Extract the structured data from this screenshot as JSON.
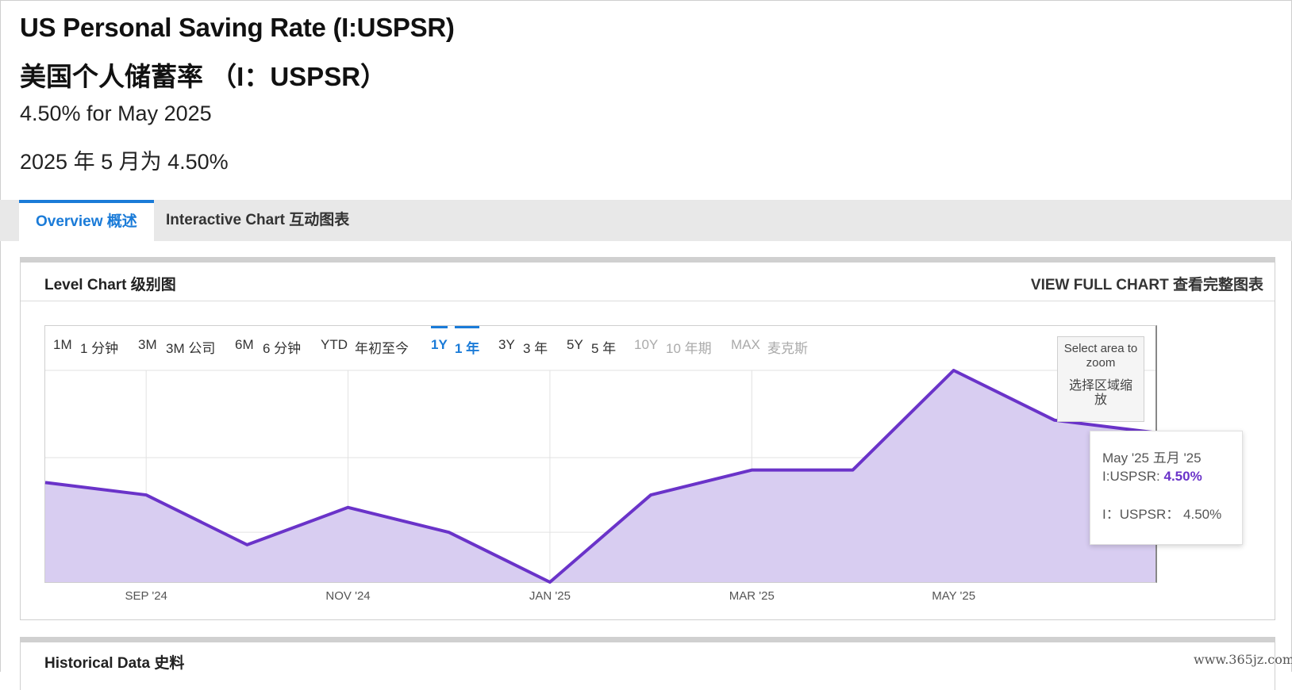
{
  "header": {
    "title_en": "US Personal Saving Rate (I:USPSR)",
    "title_zh": "美国个人储蓄率 （I：USPSR）",
    "subtitle_en": "4.50% for May 2025",
    "subtitle_zh": "2025 年 5 月为 4.50%"
  },
  "tabs": [
    {
      "label": "Overview  概述",
      "active": true
    },
    {
      "label": "Interactive Chart  互动图表",
      "active": false
    }
  ],
  "panel": {
    "title": "Level Chart  级别图",
    "full_chart_link": "VIEW FULL CHART  查看完整图表"
  },
  "ranges": [
    {
      "label": "1M",
      "state": "normal"
    },
    {
      "label": "1 分钟",
      "state": "normal"
    },
    {
      "label": "3M",
      "state": "normal"
    },
    {
      "label": "3M 公司",
      "state": "normal"
    },
    {
      "label": "6M",
      "state": "normal"
    },
    {
      "label": "6 分钟",
      "state": "normal"
    },
    {
      "label": "YTD",
      "state": "normal"
    },
    {
      "label": "年初至今",
      "state": "normal"
    },
    {
      "label": "1Y",
      "state": "selected"
    },
    {
      "label": "1 年",
      "state": "selected"
    },
    {
      "label": "3Y",
      "state": "normal"
    },
    {
      "label": "3 年",
      "state": "normal"
    },
    {
      "label": "5Y",
      "state": "normal"
    },
    {
      "label": "5 年",
      "state": "normal"
    },
    {
      "label": "10Y",
      "state": "disabled"
    },
    {
      "label": "10 年期",
      "state": "disabled"
    },
    {
      "label": "MAX",
      "state": "disabled"
    },
    {
      "label": "麦克斯",
      "state": "disabled"
    }
  ],
  "zoom_hint": {
    "en": "Select area to zoom",
    "zh": "选择区域缩放"
  },
  "tooltip": {
    "date": "May '25  五月 '25",
    "series_label": "I:USPSR:",
    "series_value": "4.50%",
    "zh_line": "I：USPSR：  4.50%"
  },
  "chart_data": {
    "type": "area",
    "x": [
      "2024-07",
      "2024-08",
      "2024-09",
      "2024-10",
      "2024-11",
      "2024-12",
      "2025-01",
      "2025-02",
      "2025-03",
      "2025-04",
      "2025-05",
      "2025-06"
    ],
    "series": [
      {
        "name": "I:USPSR",
        "values": [
          4.0,
          3.9,
          3.5,
          3.8,
          3.6,
          3.2,
          3.9,
          4.1,
          4.1,
          4.9,
          4.5,
          4.4
        ]
      }
    ],
    "x_tick_labels": [
      "SEP '24",
      "NOV '24",
      "JAN '25",
      "MAR '25",
      "MAY '25"
    ],
    "x_tick_positions": [
      1,
      3,
      5,
      7,
      9
    ],
    "ylim": [
      3.2,
      4.9
    ],
    "grid": true,
    "legend": "none",
    "line_color": "#6a33c9",
    "fill_color": "#d8cdf1"
  },
  "historical": {
    "title": "Historical Data  史料"
  },
  "watermark": "www.365jz.com"
}
